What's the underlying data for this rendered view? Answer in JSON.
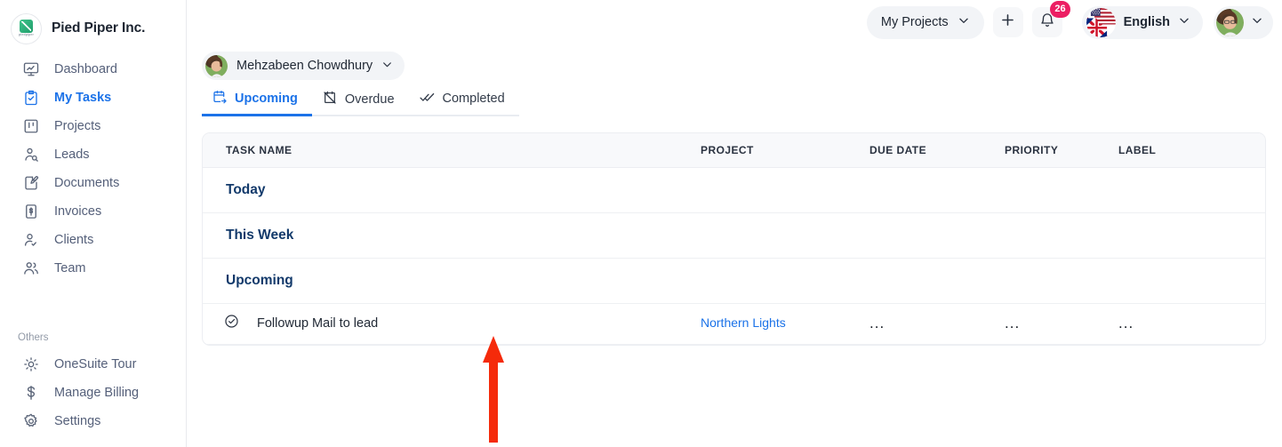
{
  "sidebar": {
    "brand": {
      "name": "Pied Piper Inc.",
      "logo_watermark": "piedpiper"
    },
    "items": [
      {
        "label": "Dashboard",
        "icon": "monitor-chart-icon",
        "active": false
      },
      {
        "label": "My Tasks",
        "icon": "clipboard-check-icon",
        "active": true
      },
      {
        "label": "Projects",
        "icon": "kanban-board-icon",
        "active": false
      },
      {
        "label": "Leads",
        "icon": "person-search-icon",
        "active": false
      },
      {
        "label": "Documents",
        "icon": "document-edit-icon",
        "active": false
      },
      {
        "label": "Invoices",
        "icon": "invoice-dollar-icon",
        "active": false
      },
      {
        "label": "Clients",
        "icon": "person-check-icon",
        "active": false
      },
      {
        "label": "Team",
        "icon": "people-group-icon",
        "active": false
      }
    ],
    "others_heading": "Others",
    "others_items": [
      {
        "label": "OneSuite Tour",
        "icon": "sun-tour-icon"
      },
      {
        "label": "Manage Billing",
        "icon": "dollar-icon"
      },
      {
        "label": "Settings",
        "icon": "gear-icon"
      }
    ]
  },
  "topbar": {
    "projects_selector": "My Projects",
    "add_label": "+",
    "notification_count": "26",
    "language": "English",
    "flag": "us-uk-flag-icon"
  },
  "content": {
    "owner": "Mehzabeen Chowdhury",
    "tabs": [
      {
        "label": "Upcoming",
        "icon": "calendar-upcoming-icon",
        "active": true
      },
      {
        "label": "Overdue",
        "icon": "calendar-overdue-icon",
        "active": false
      },
      {
        "label": "Completed",
        "icon": "double-check-icon",
        "active": false
      }
    ],
    "table": {
      "columns": [
        "TASK NAME",
        "PROJECT",
        "DUE DATE",
        "PRIORITY",
        "LABEL"
      ],
      "groups": [
        {
          "title": "Today",
          "rows": []
        },
        {
          "title": "This Week",
          "rows": []
        },
        {
          "title": "Upcoming",
          "rows": [
            {
              "name": "Followup Mail to lead",
              "project": "Northern Lights",
              "due_date": "...",
              "priority": "...",
              "label": "..."
            }
          ]
        }
      ]
    }
  },
  "annotation": {
    "arrow_color": "#f52a0a",
    "arrow_direction": "up"
  },
  "colors": {
    "accent": "#1b72e8",
    "group_heading": "#133a6b",
    "badge": "#ec1e63",
    "brand_green": "#1f9d6b"
  }
}
